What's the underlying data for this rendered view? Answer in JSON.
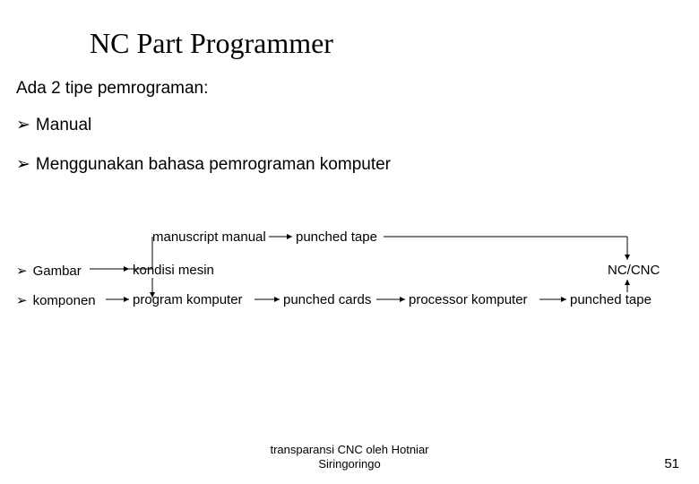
{
  "title": "NC Part Programmer",
  "intro": "Ada 2 tipe pemrograman:",
  "main_bullets": [
    "Manual",
    "Menggunakan bahasa pemrograman komputer"
  ],
  "small_bullets": [
    "Gambar",
    "komponen"
  ],
  "diagram": {
    "manuscript_manual": "manuscript manual",
    "punched_tape_top": "punched tape",
    "kondisi_mesin": "kondisi mesin",
    "program_komputer": "program komputer",
    "punched_cards": "punched cards",
    "processor_komputer": "processor komputer",
    "punched_tape_bottom": "punched tape",
    "nc_cnc": "NC/CNC"
  },
  "footer_line1": "transparansi CNC oleh Hotniar",
  "footer_line2": "Siringoringo",
  "page_number": "51"
}
